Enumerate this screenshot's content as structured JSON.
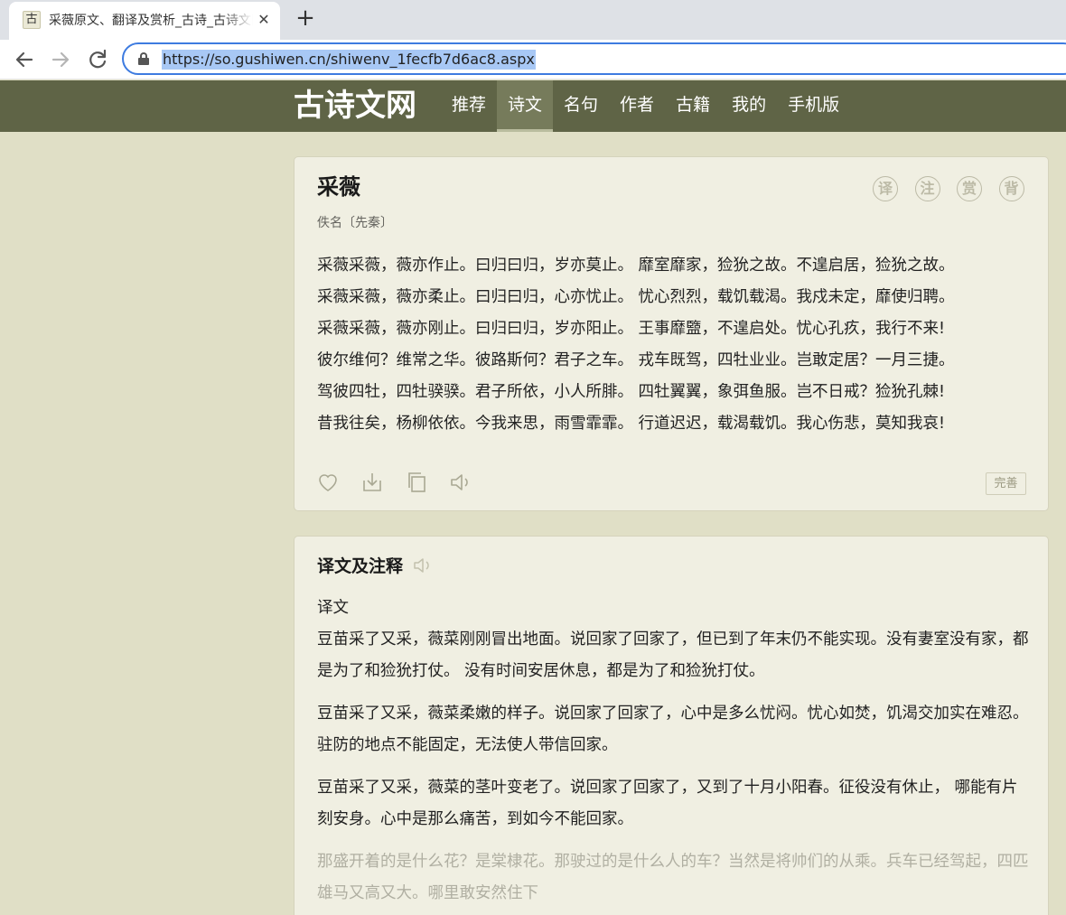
{
  "browser": {
    "tab": {
      "favicon_glyph": "古",
      "title": "采薇原文、翻译及赏析_古诗_古诗文网",
      "close_glyph": "✕"
    },
    "new_tab_glyph": "+",
    "url": "https://so.gushiwen.cn/shiwenv_1fecfb7d6ac8.aspx"
  },
  "site": {
    "logo": "古诗文网",
    "nav": [
      {
        "label": "推荐",
        "active": false
      },
      {
        "label": "诗文",
        "active": true
      },
      {
        "label": "名句",
        "active": false
      },
      {
        "label": "作者",
        "active": false
      },
      {
        "label": "古籍",
        "active": false
      },
      {
        "label": "我的",
        "active": false
      },
      {
        "label": "手机版",
        "active": false
      }
    ]
  },
  "poem": {
    "title": "采薇",
    "author_line": "佚名〔先秦〕",
    "tool_icons": [
      "译",
      "注",
      "赏",
      "背"
    ],
    "lines": [
      "采薇采薇，薇亦作止。曰归曰归，岁亦莫止。 靡室靡家，猃狁之故。不遑启居，猃狁之故。",
      "采薇采薇，薇亦柔止。曰归曰归，心亦忧止。 忧心烈烈，载饥载渴。我戍未定，靡使归聘。",
      "采薇采薇，薇亦刚止。曰归曰归，岁亦阳止。 王事靡盬，不遑启处。忧心孔疚，我行不来!",
      "彼尔维何？维常之华。彼路斯何？君子之车。 戎车既驾，四牡业业。岂敢定居？一月三捷。",
      "驾彼四牡，四牡骙骙。君子所依，小人所腓。 四牡翼翼，象弭鱼服。岂不日戒？猃狁孔棘!",
      "昔我往矣，杨柳依依。今我来思，雨雪霏霏。 行道迟迟，载渴载饥。我心伤悲，莫知我哀!"
    ],
    "actions": [
      "heart-icon",
      "download-icon",
      "copy-icon",
      "speaker-icon"
    ],
    "improve_label": "完善"
  },
  "translation": {
    "title": "译文及注释",
    "subtitle": "译文",
    "paragraphs": [
      "豆苗采了又采，薇菜刚刚冒出地面。说回家了回家了，但已到了年末仍不能实现。没有妻室没有家，都是为了和猃狁打仗。 没有时间安居休息，都是为了和猃狁打仗。",
      "豆苗采了又采，薇菜柔嫩的样子。说回家了回家了，心中是多么忧闷。忧心如焚，饥渴交加实在难忍。驻防的地点不能固定，无法使人带信回家。",
      "豆苗采了又采，薇菜的茎叶变老了。说回家了回家了，又到了十月小阳春。征役没有休止， 哪能有片刻安身。心中是那么痛苦，到如今不能回家。",
      "那盛开着的是什么花？是棠棣花。那驶过的是什么人的车？当然是将帅们的从乘。兵车已经驾起，四匹雄马又高又大。哪里敢安然住下"
    ],
    "faded_from_index": 3
  }
}
